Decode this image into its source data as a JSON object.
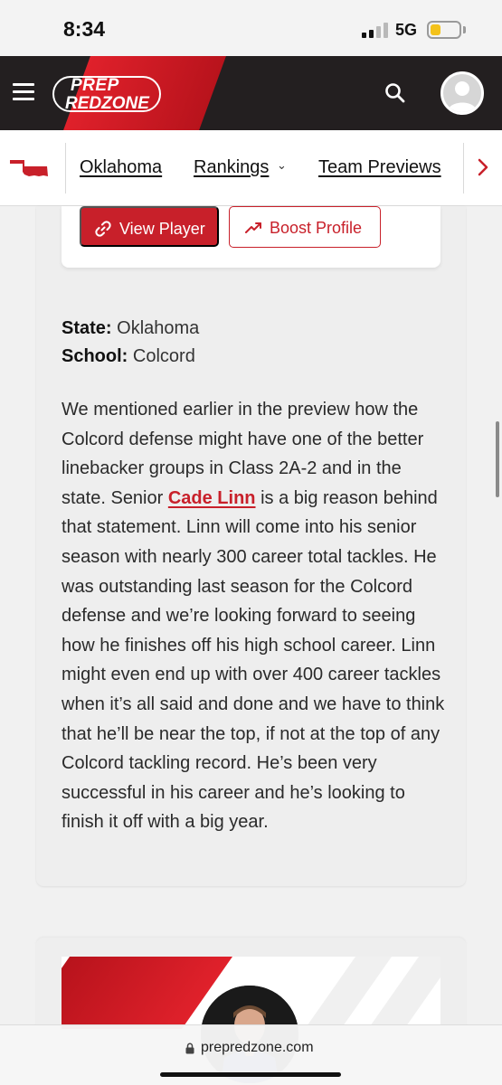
{
  "status_bar": {
    "time": "8:34",
    "network": "5G",
    "battery_level": 0.35,
    "battery_color": "#f4c21a"
  },
  "header": {
    "logo_top": "PREP",
    "logo_bottom": "REDZONE",
    "brand_color": "#c8202a",
    "icons": [
      "hamburger-menu-icon",
      "search-icon",
      "user-avatar-icon"
    ]
  },
  "sub_nav": {
    "state_icon": "oklahoma-state-icon",
    "links": [
      "Oklahoma",
      "Rankings",
      "Team Previews"
    ],
    "rankings_dropdown_icon": "chevron-down-icon",
    "next_icon": "chevron-right-icon"
  },
  "player_actions": {
    "view_player": "View Player",
    "boost_profile": "Boost Profile"
  },
  "player_info": {
    "state_label": "State:",
    "state_value": "Oklahoma",
    "school_label": "School:",
    "school_value": "Colcord"
  },
  "article": {
    "text_before": "We mentioned earlier in the preview how the Colcord defense might have one of the better linebacker groups in Class 2A-2 and in the state. Senior ",
    "player_link": "Cade Linn",
    "text_after": " is a big reason behind that statement. Linn will come into his senior season with nearly 300 career total tackles. He was outstanding last season for the Colcord defense and we’re looking forward to seeing how he finishes off his high school career. Linn might even end up with over 400 career tackles when it’s all said and done and we have to think that he’ll be near the top, if not at the top of any Colcord tackling record. He’s been very successful in his career and he’s looking to finish it off with a big year."
  },
  "browser": {
    "url": "prepredzone.com"
  }
}
